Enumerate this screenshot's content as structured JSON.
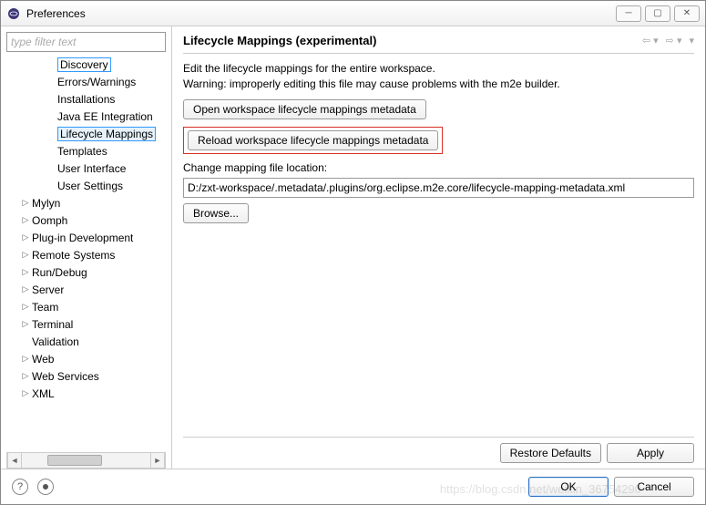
{
  "window": {
    "title": "Preferences"
  },
  "sidebar": {
    "filter_placeholder": "type filter text",
    "items": [
      {
        "label": "Discovery",
        "indent": 2,
        "twisty": "",
        "boxed": true
      },
      {
        "label": "Errors/Warnings",
        "indent": 2,
        "twisty": ""
      },
      {
        "label": "Installations",
        "indent": 2,
        "twisty": ""
      },
      {
        "label": "Java EE Integration",
        "indent": 2,
        "twisty": ""
      },
      {
        "label": "Lifecycle Mappings",
        "indent": 2,
        "twisty": "",
        "selected": true
      },
      {
        "label": "Templates",
        "indent": 2,
        "twisty": ""
      },
      {
        "label": "User Interface",
        "indent": 2,
        "twisty": ""
      },
      {
        "label": "User Settings",
        "indent": 2,
        "twisty": ""
      },
      {
        "label": "Mylyn",
        "indent": 1,
        "twisty": "▷"
      },
      {
        "label": "Oomph",
        "indent": 1,
        "twisty": "▷"
      },
      {
        "label": "Plug-in Development",
        "indent": 1,
        "twisty": "▷"
      },
      {
        "label": "Remote Systems",
        "indent": 1,
        "twisty": "▷"
      },
      {
        "label": "Run/Debug",
        "indent": 1,
        "twisty": "▷"
      },
      {
        "label": "Server",
        "indent": 1,
        "twisty": "▷"
      },
      {
        "label": "Team",
        "indent": 1,
        "twisty": "▷"
      },
      {
        "label": "Terminal",
        "indent": 1,
        "twisty": "▷"
      },
      {
        "label": "Validation",
        "indent": 1,
        "twisty": ""
      },
      {
        "label": "Web",
        "indent": 1,
        "twisty": "▷"
      },
      {
        "label": "Web Services",
        "indent": 1,
        "twisty": "▷"
      },
      {
        "label": "XML",
        "indent": 1,
        "twisty": "▷"
      }
    ]
  },
  "main": {
    "heading": "Lifecycle Mappings (experimental)",
    "description_line1": "Edit the lifecycle mappings for the entire workspace.",
    "description_line2": "Warning: improperly editing this file may cause problems with the m2e builder.",
    "open_button": "Open workspace lifecycle mappings metadata",
    "reload_button": "Reload workspace lifecycle mappings metadata",
    "location_label": "Change mapping file location:",
    "location_value": "D:/zxt-workspace/.metadata/.plugins/org.eclipse.m2e.core/lifecycle-mapping-metadata.xml",
    "browse_button": "Browse...",
    "restore_button": "Restore Defaults",
    "apply_button": "Apply"
  },
  "footer": {
    "ok": "OK",
    "cancel": "Cancel"
  },
  "watermark": "https://blog.csdn.net/weixin_36754290"
}
